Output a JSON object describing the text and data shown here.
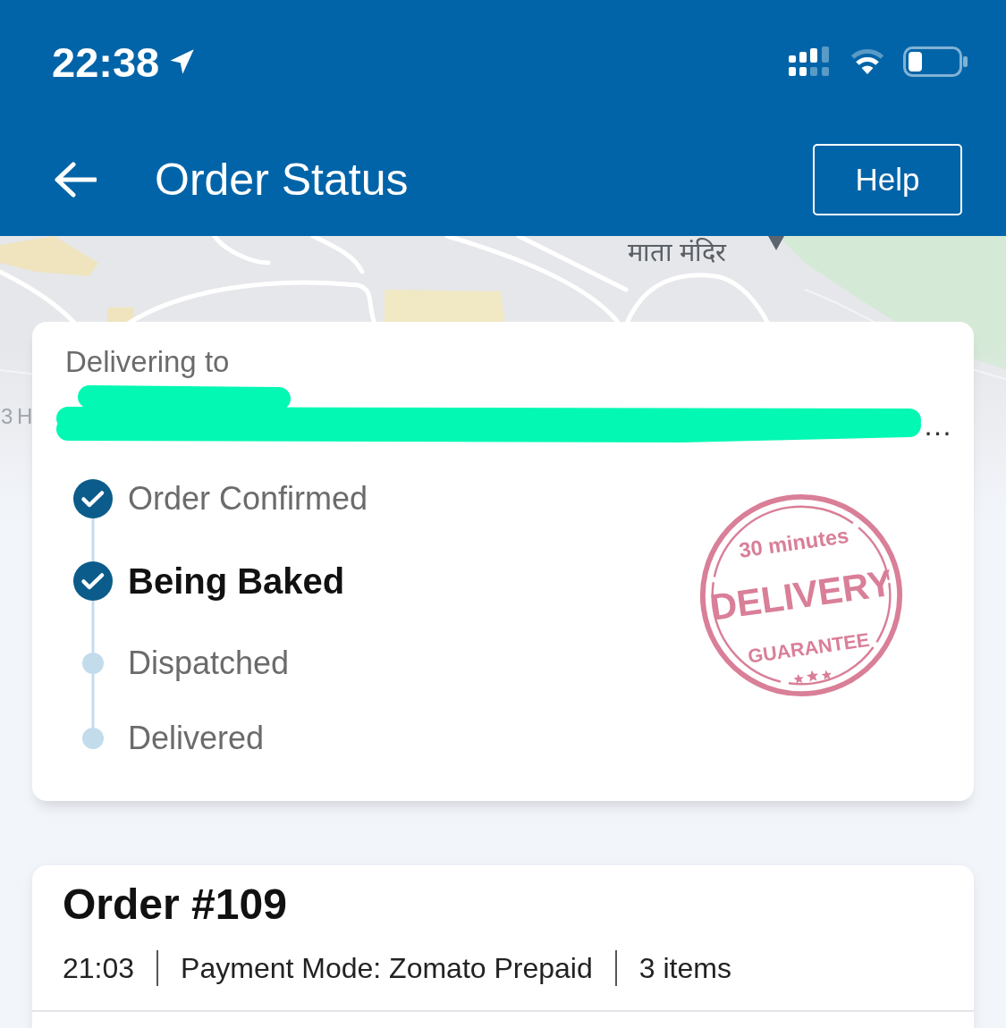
{
  "status_bar": {
    "time": "22:38"
  },
  "header": {
    "title": "Order Status",
    "help_button": "Help"
  },
  "map": {
    "labels": [
      {
        "text": "माता मंदिर"
      },
      {
        "text": "3 H"
      }
    ]
  },
  "delivery_card": {
    "heading": "Delivering to",
    "address": {
      "redacted": true,
      "visible_text": "…"
    },
    "steps": [
      {
        "label": "Order Confirmed",
        "done": true,
        "current": false
      },
      {
        "label": "Being Baked",
        "done": true,
        "current": true
      },
      {
        "label": "Dispatched",
        "done": false,
        "current": false
      },
      {
        "label": "Delivered",
        "done": false,
        "current": false
      }
    ],
    "stamp": {
      "lines": [
        {
          "kind": "top",
          "text": "30 minutes"
        },
        {
          "kind": "main",
          "text": "DELIVERY"
        },
        {
          "kind": "bottom",
          "text": "GUARANTEE"
        }
      ]
    }
  },
  "order_card": {
    "title": "Order #109",
    "meta": [
      "21:03",
      "Payment Mode: Zomato Prepaid",
      "3 items"
    ]
  }
}
